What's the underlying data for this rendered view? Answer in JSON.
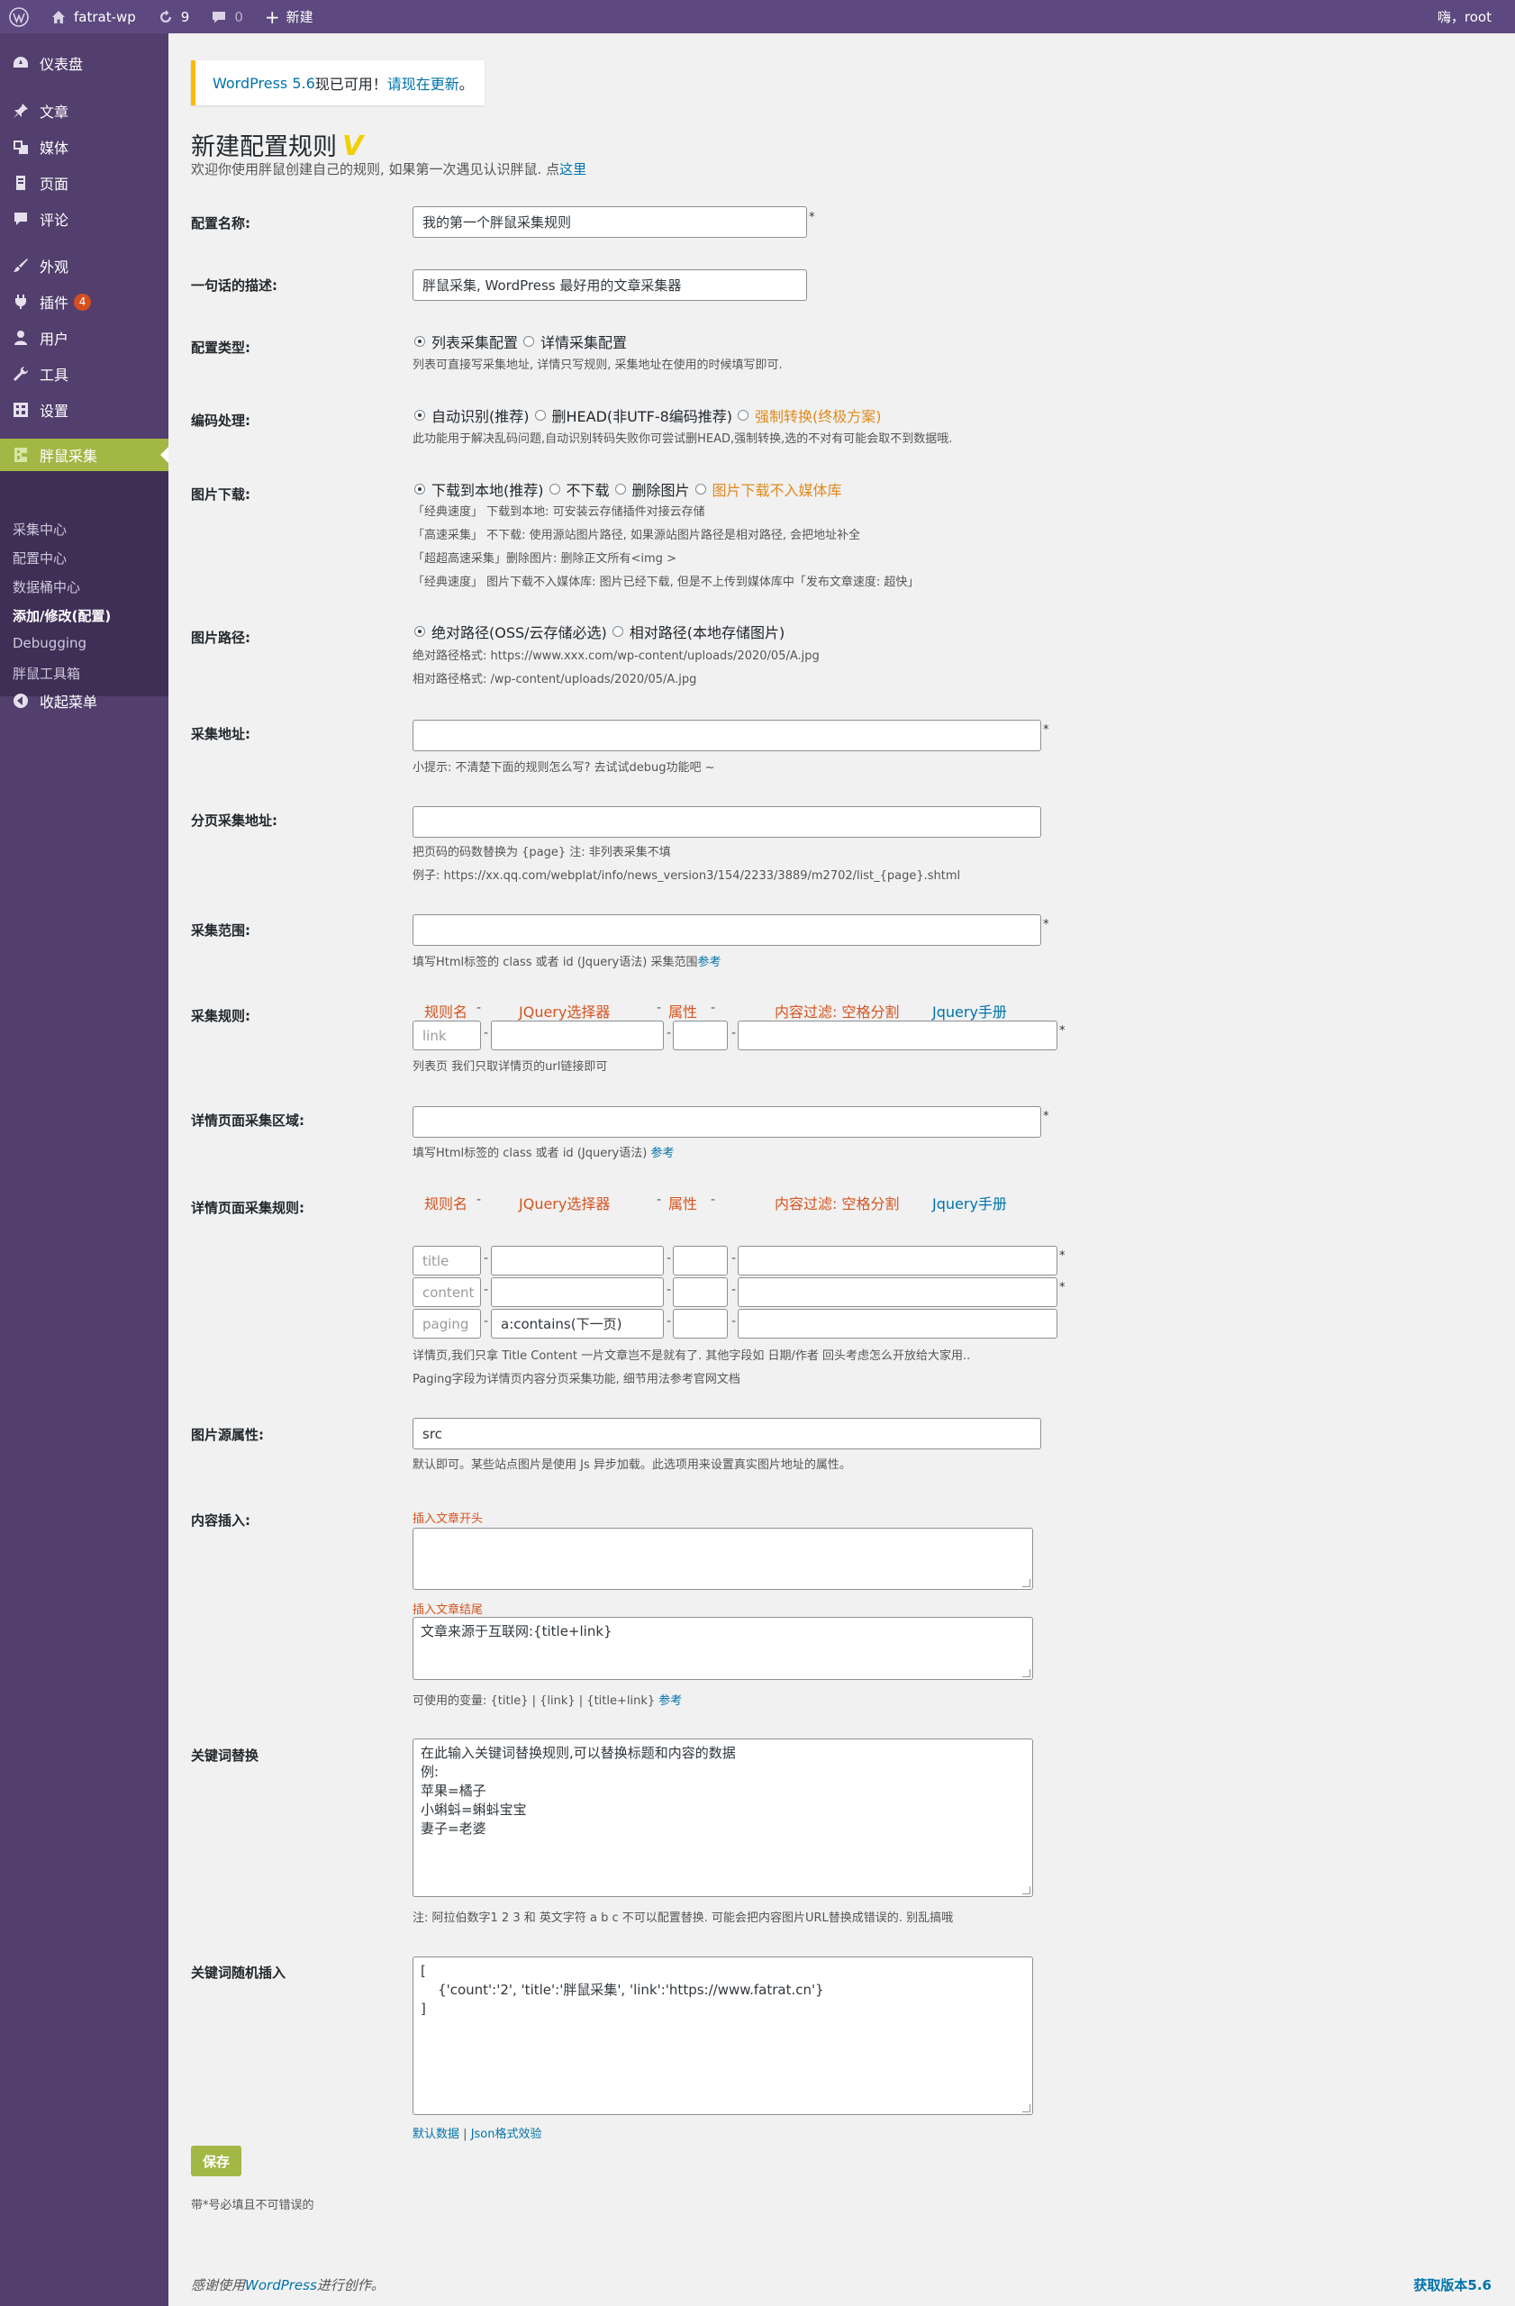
{
  "adminbar": {
    "site_name": "fatrat-wp",
    "updates_count": "9",
    "comments_count": "0",
    "new_label": "新建",
    "greeting": "嗨，root"
  },
  "sidebar": {
    "items": [
      {
        "label": "仪表盘",
        "icon": "dashboard-icon"
      },
      {
        "label": "文章",
        "icon": "pin-icon"
      },
      {
        "label": "媒体",
        "icon": "media-icon"
      },
      {
        "label": "页面",
        "icon": "page-icon"
      },
      {
        "label": "评论",
        "icon": "comment-icon"
      },
      {
        "label": "外观",
        "icon": "brush-icon"
      },
      {
        "label": "插件",
        "icon": "plugin-icon",
        "badge": "4"
      },
      {
        "label": "用户",
        "icon": "user-icon"
      },
      {
        "label": "工具",
        "icon": "wrench-icon"
      },
      {
        "label": "设置",
        "icon": "settings-icon"
      },
      {
        "label": "胖鼠采集",
        "icon": "fatrat-icon"
      },
      {
        "label": "收起菜单",
        "icon": "collapse-icon"
      }
    ],
    "submenu": [
      "采集中心",
      "配置中心",
      "数据桶中心",
      "添加/修改(配置)",
      "Debugging",
      "胖鼠工具箱"
    ]
  },
  "notice": {
    "prefix": "WordPress 5.6",
    "middle": "现已可用！",
    "link": "请现在更新",
    "suffix": "。"
  },
  "page": {
    "title": "新建配置规则",
    "checkmark": "V",
    "intro_text": "欢迎你使用胖鼠创建自己的规则, 如果第一次遇见认识胖鼠. 点",
    "intro_link": "这里"
  },
  "form": {
    "config_name": {
      "label": "配置名称:",
      "value": "我的第一个胖鼠采集规则",
      "star": "*"
    },
    "description": {
      "label": "一句话的描述:",
      "value": "胖鼠采集, WordPress 最好用的文章采集器"
    },
    "config_type": {
      "label": "配置类型:",
      "options": [
        "列表采集配置",
        "详情采集配置"
      ],
      "desc": "列表可直接写采集地址, 详情只写规则, 采集地址在使用的时候填写即可."
    },
    "encoding": {
      "label": "编码处理:",
      "options": [
        "自动识别(推荐)",
        "删HEAD(非UTF-8编码推荐)",
        "强制转换(终极方案)"
      ],
      "desc": "此功能用于解决乱码问题,自动识别转码失败你可尝试删HEAD,强制转换,选的不对有可能会取不到数据哦."
    },
    "image_download": {
      "label": "图片下载:",
      "options": [
        "下载到本地(推荐)",
        "不下载",
        "删除图片",
        "图片下载不入媒体库"
      ],
      "desc_lines": [
        "「经典速度」 下载到本地: 可安装云存储插件对接云存储",
        "「高速采集」 不下载: 使用源站图片路径, 如果源站图片路径是相对路径, 会把地址补全",
        "「超超高速采集」删除图片: 删除正文所有<img >",
        "「经典速度」 图片下载不入媒体库: 图片已经下载, 但是不上传到媒体库中「发布文章速度: 超快」"
      ]
    },
    "image_path": {
      "label": "图片路径:",
      "options": [
        "绝对路径(OSS/云存储必选)",
        "相对路径(本地存储图片)"
      ],
      "desc_lines": [
        "绝对路径格式: https://www.xxx.com/wp-content/uploads/2020/05/A.jpg",
        "相对路径格式: /wp-content/uploads/2020/05/A.jpg"
      ]
    },
    "collect_url": {
      "label": "采集地址:",
      "hint": "小提示: 不清楚下面的规则怎么写? 去试试debug功能吧 ~"
    },
    "paging_url": {
      "label": "分页采集地址:",
      "desc_lines": [
        "把页码的码数替换为 {page} 注: 非列表采集不填",
        "例子: https://xx.qq.com/webplat/info/news_version3/154/2233/3889/m2702/list_{page}.shtml"
      ]
    },
    "range": {
      "label": "采集范围:",
      "desc": "填写Html标签的 class 或者 id (Jquery语法) 采集范围",
      "link": "参考"
    },
    "rules_header": {
      "name": "规则名",
      "selector": "JQuery选择器",
      "attr": "属性",
      "filter": "内容过滤: 空格分割",
      "manual": "Jquery手册"
    },
    "collect_rules": {
      "label": "采集规则:",
      "row_name": "link",
      "desc": "列表页 我们只取详情页的url链接即可"
    },
    "detail_area": {
      "label": "详情页面采集区域:",
      "desc": "填写Html标签的 class 或者 id (Jquery语法)",
      "link": "参考"
    },
    "detail_rules": {
      "label": "详情页面采集规则:",
      "rows": [
        {
          "name": "title",
          "selector": ""
        },
        {
          "name": "content",
          "selector": ""
        },
        {
          "name": "paging",
          "selector": "a:contains(下一页)"
        }
      ],
      "desc_lines": [
        "详情页,我们只拿 Title Content 一片文章岂不是就有了. 其他字段如 日期/作者 回头考虑怎么开放给大家用..",
        "Paging字段为详情页内容分页采集功能, 细节用法参考官网文档"
      ]
    },
    "image_src": {
      "label": "图片源属性:",
      "value": "src",
      "desc": "默认即可。某些站点图片是使用 Js 异步加载。此选项用来设置真实图片地址的属性。"
    },
    "content_insert": {
      "label": "内容插入:",
      "head_label": "插入文章开头",
      "head_value": "",
      "tail_label": "插入文章结尾",
      "tail_value": "文章来源于互联网:{title+link}",
      "vars_text": "可使用的变量: {title} | {link} | {title+link}",
      "vars_link": "参考"
    },
    "keyword_replace": {
      "label": "关键词替换",
      "value": "在此输入关键词替换规则,可以替换标题和内容的数据\n例:\n苹果=橘子\n小蝌蚪=蝌蚪宝宝\n妻子=老婆",
      "desc": "注: 阿拉伯数字1 2 3 和 英文字符 a b c 不可以配置替换. 可能会把内容图片URL替换成错误的. 别乱搞哦"
    },
    "keyword_random": {
      "label": "关键词随机插入",
      "value": "[\n    {'count':'2', 'title':'胖鼠采集', 'link':'https://www.fatrat.cn'}\n]",
      "link_default": "默认数据",
      "separator": "|",
      "link_json": "Json格式效验"
    },
    "save_label": "保存",
    "required_note": "带*号必填且不可错误的"
  },
  "footer": {
    "left_text": "感谢使用",
    "left_link": "WordPress",
    "left_suffix": "进行创作。",
    "right": "获取版本5.6"
  },
  "colors": {
    "adminbar": "#5d4980",
    "sidebar": "#523f6d",
    "submenu": "#3f2f56",
    "accent": "#a3b745",
    "link": "#0073aa",
    "orange": "#e08a1d",
    "notice_border": "#ffb900"
  }
}
